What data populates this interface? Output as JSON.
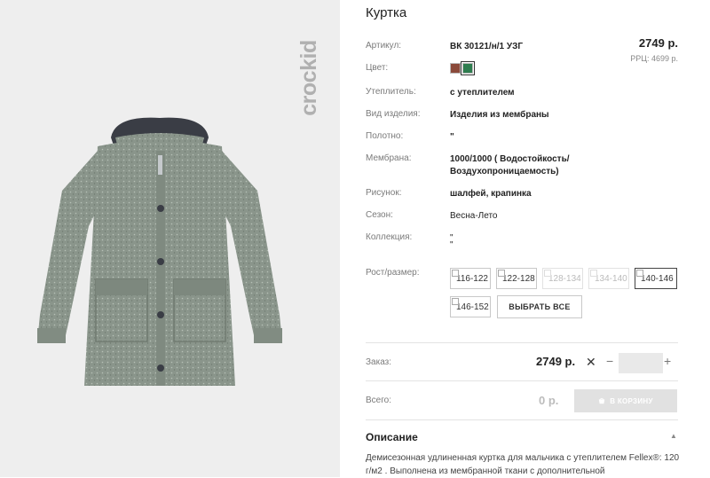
{
  "product": {
    "title": "Куртка",
    "brand": "crockid",
    "price": "2749 р.",
    "rrc": "РРЦ: 4699 р."
  },
  "attributes": {
    "article": {
      "label": "Артикул:",
      "value": "ВК 30121/н/1 УЗГ"
    },
    "color": {
      "label": "Цвет:",
      "swatches": [
        "#8b4a3a",
        "#2e7d4f"
      ]
    },
    "insulation": {
      "label": "Утеплитель:",
      "value": "с утеплителем"
    },
    "type": {
      "label": "Вид изделия:",
      "value": "Изделия из мембраны"
    },
    "fabric": {
      "label": "Полотно:",
      "value": "\""
    },
    "membrane": {
      "label": "Мембрана:",
      "value_line1": "1000/1000 ( Водостойкость/",
      "value_line2": "Воздухопроницаемость)"
    },
    "pattern": {
      "label": "Рисунок:",
      "value": "шалфей, крапинка"
    },
    "season": {
      "label": "Сезон:",
      "value": "Весна-Лето"
    },
    "collection": {
      "label": "Коллекция:",
      "value_line1": "\"",
      "value_line2": "\""
    },
    "size": {
      "label": "Рост/размер:"
    }
  },
  "sizes": [
    {
      "label": "116-122",
      "state": "normal"
    },
    {
      "label": "122-128",
      "state": "normal"
    },
    {
      "label": "128-134",
      "state": "disabled"
    },
    {
      "label": "134-140",
      "state": "disabled"
    },
    {
      "label": "140-146",
      "state": "active"
    },
    {
      "label": "146-152",
      "state": "normal"
    }
  ],
  "select_all_label": "ВЫБРАТЬ ВСЕ",
  "order": {
    "label": "Заказ:",
    "price": "2749 р.",
    "remove_glyph": "✕",
    "minus": "−",
    "plus": "+",
    "qty": ""
  },
  "total": {
    "label": "Всего:",
    "value": "0 р.",
    "cart_button": "В КОРЗИНУ"
  },
  "description": {
    "title": "Описание",
    "toggle": "▲",
    "text": "Демисезонная удлиненная куртка для мальчика с утеплителем Fellex®: 120 г/м2 . Выполнена из мембранной ткани с дополнительной"
  }
}
